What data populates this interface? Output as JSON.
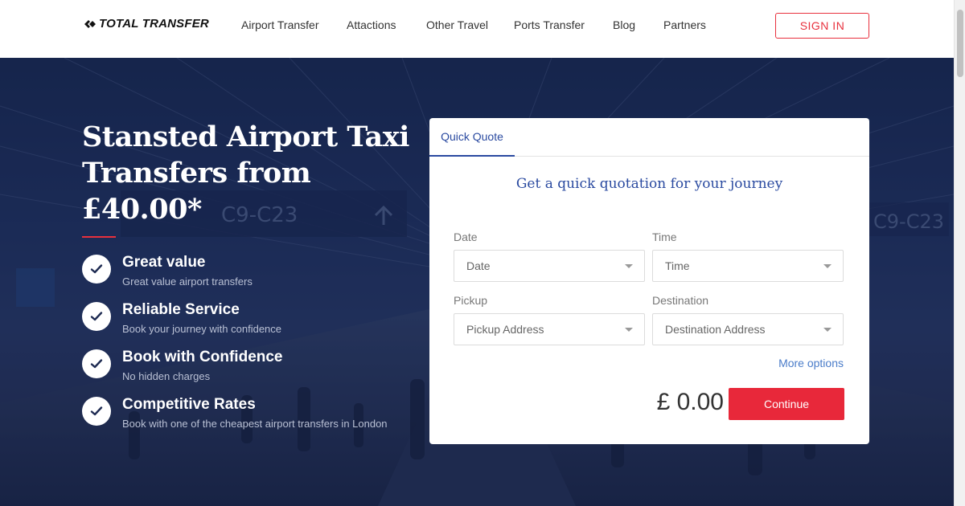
{
  "brand": {
    "name": "TOTAL TRANSFER",
    "accent": "#e8303d",
    "link_blue": "#2a4aa0"
  },
  "nav": {
    "items": [
      "Airport Transfer",
      "Attactions",
      "Other Travel",
      "Ports Transfer",
      "Blog",
      "Partners"
    ],
    "signin": "SIGN IN"
  },
  "hero": {
    "title": "Stansted Airport Taxi Transfers from £40.00*",
    "features": [
      {
        "title": "Great value",
        "desc": "Great value airport transfers"
      },
      {
        "title": "Reliable Service",
        "desc": "Book your journey with confidence"
      },
      {
        "title": "Book with Confidence",
        "desc": "No hidden charges"
      },
      {
        "title": "Competitive Rates",
        "desc": "Book with one of the cheapest airport transfers in London"
      }
    ]
  },
  "quote": {
    "tab": "Quick Quote",
    "heading": "Get a quick quotation for your journey",
    "date_label": "Date",
    "date_placeholder": "Date",
    "time_label": "Time",
    "time_placeholder": "Time",
    "pickup_label": "Pickup",
    "pickup_placeholder": "Pickup Address",
    "destination_label": "Destination",
    "destination_placeholder": "Destination Address",
    "more_options": "More options",
    "price": "£ 0.00",
    "continue": "Continue"
  }
}
